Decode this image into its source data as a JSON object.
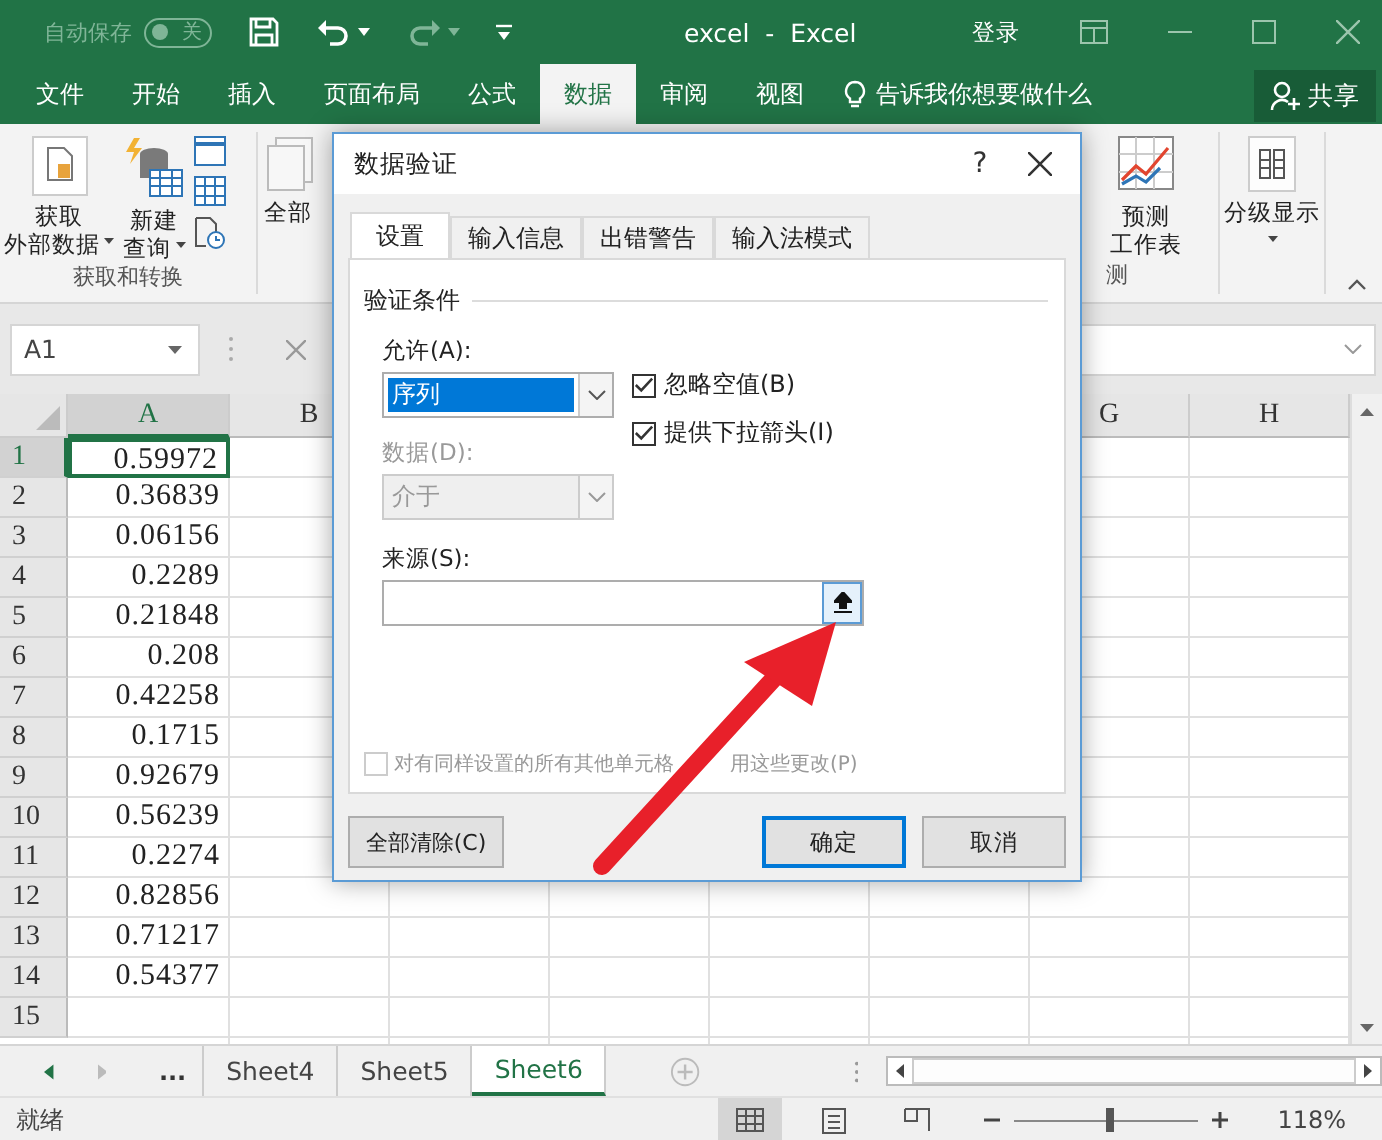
{
  "title_bar": {
    "autosave": {
      "label": "自动保存",
      "state_label": "关",
      "on": false
    },
    "title": "excel  -  Excel",
    "sign_in": "登录"
  },
  "ribbon_tabs": [
    {
      "label": "文件",
      "selected": false
    },
    {
      "label": "开始",
      "selected": false
    },
    {
      "label": "插入",
      "selected": false
    },
    {
      "label": "页面布局",
      "selected": false
    },
    {
      "label": "公式",
      "selected": false
    },
    {
      "label": "数据",
      "selected": true
    },
    {
      "label": "审阅",
      "selected": false
    },
    {
      "label": "视图",
      "selected": false
    }
  ],
  "tell_me": "告诉我你想要做什么",
  "share": "共享",
  "ribbon": {
    "get_external_data": [
      "获取",
      "外部数据"
    ],
    "new_query": [
      "新建",
      "查询"
    ],
    "group_get_transform": "获取和转换",
    "refresh_all_partial": "全部",
    "forecast_sheet": [
      "预测",
      "工作表"
    ],
    "group_forecast_partial": "测",
    "outline": "分级显示"
  },
  "formula_bar": {
    "name_box": "A1"
  },
  "sheet": {
    "columns": [
      {
        "label": "A",
        "selected": true
      },
      {
        "label": "B",
        "selected": false
      },
      {
        "label": "G",
        "selected": false
      },
      {
        "label": "H",
        "selected": false
      }
    ],
    "rows": [
      {
        "number": "1",
        "value": "0.59972",
        "selected": true
      },
      {
        "number": "2",
        "value": "0.36839",
        "selected": false
      },
      {
        "number": "3",
        "value": "0.06156",
        "selected": false
      },
      {
        "number": "4",
        "value": "0.2289",
        "selected": false
      },
      {
        "number": "5",
        "value": "0.21848",
        "selected": false
      },
      {
        "number": "6",
        "value": "0.208",
        "selected": false
      },
      {
        "number": "7",
        "value": "0.42258",
        "selected": false
      },
      {
        "number": "8",
        "value": "0.1715",
        "selected": false
      },
      {
        "number": "9",
        "value": "0.92679",
        "selected": false
      },
      {
        "number": "10",
        "value": "0.56239",
        "selected": false
      },
      {
        "number": "11",
        "value": "0.2274",
        "selected": false
      },
      {
        "number": "12",
        "value": "0.82856",
        "selected": false
      },
      {
        "number": "13",
        "value": "0.71217",
        "selected": false
      },
      {
        "number": "14",
        "value": "0.54377",
        "selected": false
      },
      {
        "number": "15",
        "selected": false
      }
    ]
  },
  "sheet_tabs": {
    "more": "...",
    "tabs": [
      {
        "label": "Sheet4",
        "selected": false
      },
      {
        "label": "Sheet5",
        "selected": false
      },
      {
        "label": "Sheet6",
        "selected": true
      }
    ]
  },
  "status_bar": {
    "status": "就绪",
    "views": [
      {
        "kind": "normal",
        "selected": true
      },
      {
        "kind": "page_layout",
        "selected": false
      },
      {
        "kind": "page_break",
        "selected": false
      }
    ],
    "zoom_slider": {
      "level": 0.53
    },
    "zoom": "118%"
  },
  "dialog": {
    "title": "数据验证",
    "help": "?",
    "tabs": [
      {
        "label": "设置",
        "selected": true
      },
      {
        "label": "输入信息",
        "selected": false
      },
      {
        "label": "出错警告",
        "selected": false
      },
      {
        "label": "输入法模式",
        "selected": false
      }
    ],
    "section": "验证条件",
    "allow": {
      "label": "允许(A):",
      "value": "序列",
      "focused": true,
      "disabled": false
    },
    "ignore_blank": {
      "label": "忽略空值(B)",
      "checked": true
    },
    "in_cell_dropdown": {
      "label": "提供下拉箭头(I)",
      "checked": true
    },
    "data": {
      "label": "数据(D):",
      "value": "介于",
      "focused": false,
      "disabled": true
    },
    "source_label": "来源(S):",
    "apply_all": {
      "parts": [
        "对有同样设置的所有其他单元格",
        "用这些更改(P)"
      ],
      "checked": false,
      "disabled": true
    },
    "buttons": [
      {
        "label": "全部清除(C)",
        "kind": "clear"
      },
      {
        "label": "确定",
        "kind": "default"
      },
      {
        "label": "取消",
        "kind": "cancel"
      }
    ]
  }
}
